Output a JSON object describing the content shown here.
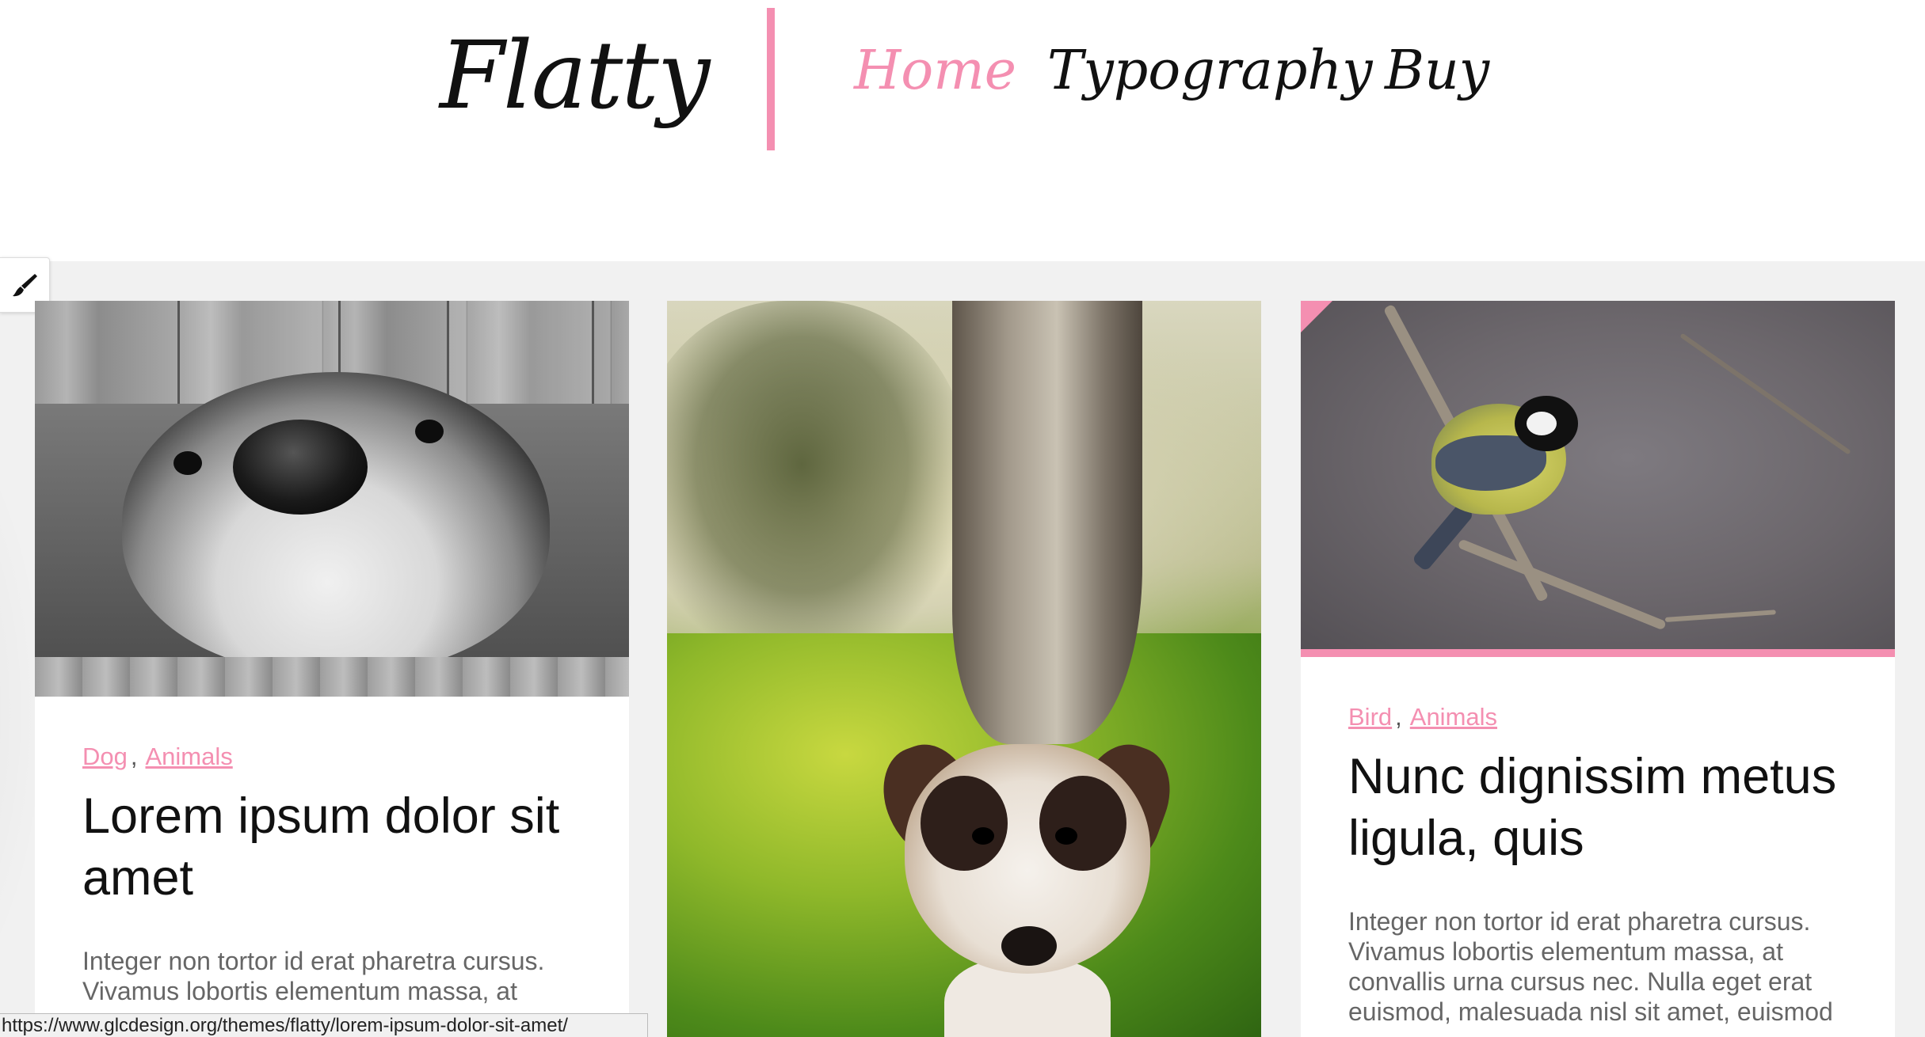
{
  "header": {
    "logo": "Flatty",
    "nav": [
      {
        "label": "Home",
        "active": true
      },
      {
        "label": "Typography"
      },
      {
        "label": "Buy"
      }
    ],
    "accent_color": "#f48fb1"
  },
  "tool": {
    "icon": "paintbrush-icon"
  },
  "cards": [
    {
      "image": "bw-dog-under-fence",
      "tags": [
        "Dog",
        "Animals"
      ],
      "title": "Lorem ipsum dolor sit amet",
      "excerpt": "Integer non tortor id erat pharetra cursus. Vivamus lobortis elementum massa, at"
    },
    {
      "image": "puppy-under-tree"
    },
    {
      "image": "bird-on-branch",
      "tags": [
        "Bird",
        "Animals"
      ],
      "title": "Nunc dignissim metus ligula, quis",
      "excerpt": "Integer non tortor id erat pharetra cursus. Vivamus lobortis elementum massa, at convallis urna cursus nec. Nulla eget erat euismod, malesuada nisl sit amet, euismod"
    }
  ],
  "statusbar": {
    "url": "https://www.glcdesign.org/themes/flatty/lorem-ipsum-dolor-sit-amet/"
  }
}
